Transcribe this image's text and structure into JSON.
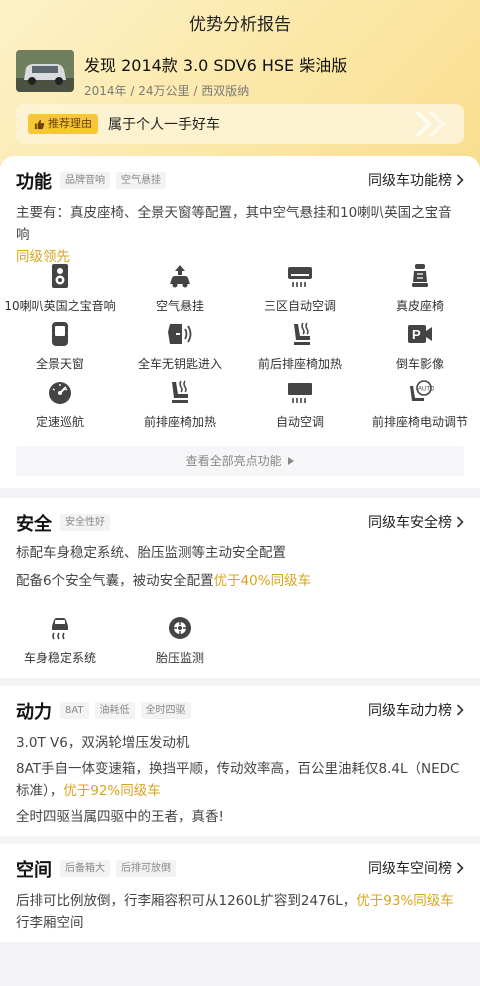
{
  "header": {
    "title": "优势分析报告"
  },
  "car": {
    "name": "发现 2014款 3.0 SDV6 HSE 柴油版",
    "year": "2014年",
    "mileage": "24万公里",
    "location": "西双版纳",
    "sep": "/"
  },
  "reason": {
    "tag": "推荐理由",
    "text": "属于个人一手好车"
  },
  "function_section": {
    "title": "功能",
    "tags": [
      "品牌音响",
      "空气悬挂"
    ],
    "rank_link": "同级车功能榜",
    "desc": "主要有：真皮座椅、全景天窗等配置，其中空气悬挂和10喇叭英国之宝音响",
    "desc_highlight": "同级领先",
    "features": [
      {
        "label": "10喇叭英国之宝音响",
        "icon": "speaker-icon"
      },
      {
        "label": "空气悬挂",
        "icon": "air-suspension-icon"
      },
      {
        "label": "三区自动空调",
        "icon": "ac-icon"
      },
      {
        "label": "真皮座椅",
        "icon": "leather-seat-icon"
      },
      {
        "label": "全景天窗",
        "icon": "panoramic-roof-icon"
      },
      {
        "label": "全车无钥匙进入",
        "icon": "keyless-entry-icon"
      },
      {
        "label": "前后排座椅加热",
        "icon": "seat-heating-icon"
      },
      {
        "label": "倒车影像",
        "icon": "reverse-camera-icon"
      },
      {
        "label": "定速巡航",
        "icon": "cruise-control-icon"
      },
      {
        "label": "前排座椅加热",
        "icon": "front-seat-heating-icon"
      },
      {
        "label": "自动空调",
        "icon": "auto-ac-icon"
      },
      {
        "label": "前排座椅电动调节",
        "icon": "power-seat-icon"
      }
    ],
    "see_all": "查看全部亮点功能"
  },
  "safety_section": {
    "title": "安全",
    "tags": [
      "安全性好"
    ],
    "rank_link": "同级车安全榜",
    "line1": "标配车身稳定系统、胎压监测等主动安全配置",
    "line2": "配备6个安全气囊，被动安全配置",
    "line2_highlight": "优于40%同级车",
    "features": [
      {
        "label": "车身稳定系统",
        "icon": "stability-control-icon"
      },
      {
        "label": "胎压监测",
        "icon": "tire-pressure-icon"
      }
    ]
  },
  "power_section": {
    "title": "动力",
    "tags": [
      "8AT",
      "油耗低",
      "全时四驱"
    ],
    "rank_link": "同级车动力榜",
    "line1": "3.0T V6，双涡轮增压发动机",
    "line2": "8AT手自一体变速箱，换挡平顺，传动效率高，百公里油耗仅8.4L（NEDC标准），",
    "line2_highlight": "优于92%同级车",
    "line3": "全时四驱当属四驱中的王者，真香!"
  },
  "space_section": {
    "title": "空间",
    "tags": [
      "后备箱大",
      "后排可放倒"
    ],
    "rank_link": "同级车空间榜",
    "line1": "后排可比例放倒，行李厢容积可从1260L扩容到2476L，",
    "line1_highlight": "优于93%同级车",
    "line1_tail": "行李厢空间"
  },
  "colors": {
    "accent": "#d8a51e",
    "tag_bg": "#f8c736"
  }
}
